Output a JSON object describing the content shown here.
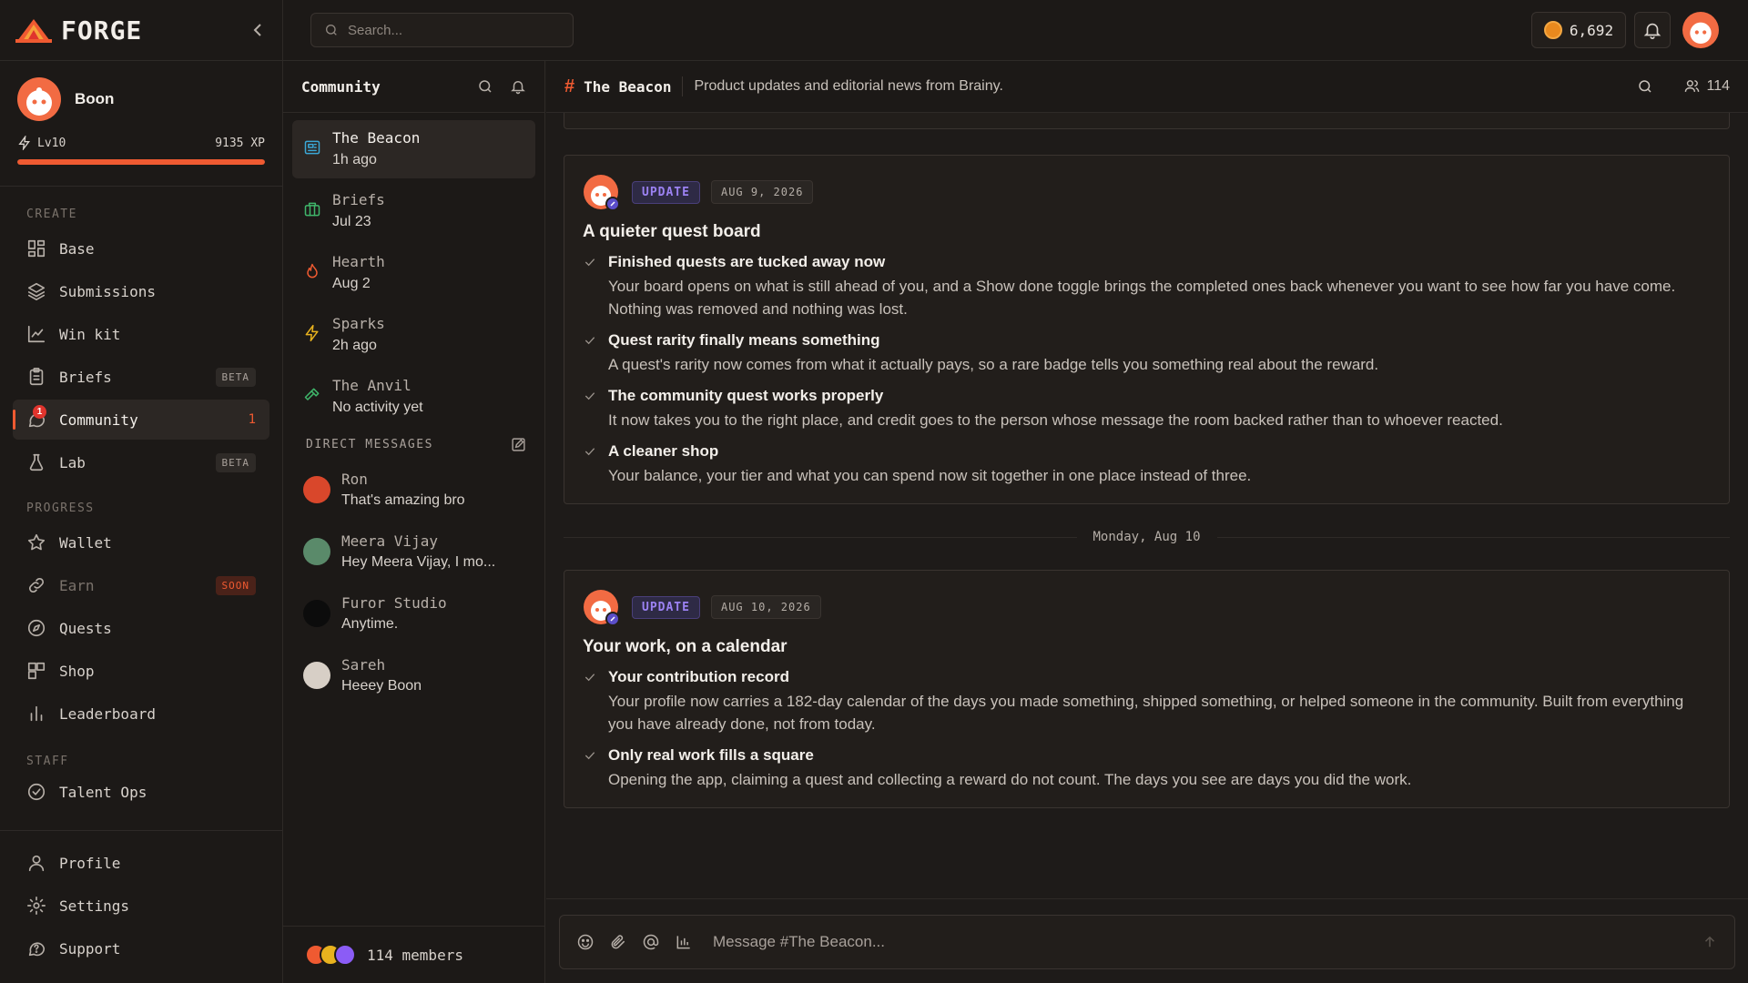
{
  "app": {
    "name": "FORGE",
    "brand_color": "#ef5a31"
  },
  "topbar": {
    "search_placeholder": "Search...",
    "coins": "6,692"
  },
  "user": {
    "name": "Boon",
    "level": "Lv10",
    "xp": "9135 XP",
    "xp_progress": 1.0
  },
  "sidebar": {
    "sections": {
      "create": "CREATE",
      "progress": "PROGRESS",
      "staff": "STAFF"
    },
    "create_items": [
      {
        "label": "Base",
        "icon": "grid-icon"
      },
      {
        "label": "Submissions",
        "icon": "layers-icon"
      },
      {
        "label": "Win kit",
        "icon": "chart-line-icon"
      },
      {
        "label": "Briefs",
        "icon": "clipboard-icon",
        "badge": "BETA"
      },
      {
        "label": "Community",
        "icon": "chat-icon",
        "count": "1",
        "dot": "1"
      },
      {
        "label": "Lab",
        "icon": "flask-icon",
        "badge": "BETA"
      }
    ],
    "progress_items": [
      {
        "label": "Wallet",
        "icon": "star-icon"
      },
      {
        "label": "Earn",
        "icon": "link-icon",
        "badge": "SOON"
      },
      {
        "label": "Quests",
        "icon": "compass-icon"
      },
      {
        "label": "Shop",
        "icon": "blocks-icon"
      },
      {
        "label": "Leaderboard",
        "icon": "bar-chart-icon"
      }
    ],
    "staff_items": [
      {
        "label": "Talent Ops",
        "icon": "check-circle-icon"
      }
    ],
    "bottom_items": [
      {
        "label": "Profile",
        "icon": "user-icon"
      },
      {
        "label": "Settings",
        "icon": "gear-icon"
      },
      {
        "label": "Support",
        "icon": "help-icon"
      }
    ]
  },
  "community": {
    "title": "Community",
    "channels": [
      {
        "name": "The Beacon",
        "sub": "1h ago",
        "icon": "newspaper-icon",
        "color": "#3ba7d6"
      },
      {
        "name": "Briefs",
        "sub": "Jul 23",
        "icon": "briefcase-icon",
        "color": "#3fb56a"
      },
      {
        "name": "Hearth",
        "sub": "Aug 2",
        "icon": "flame-icon",
        "color": "#ef5a31"
      },
      {
        "name": "Sparks",
        "sub": "2h ago",
        "icon": "bolt-icon",
        "color": "#e8b21e"
      },
      {
        "name": "The Anvil",
        "sub": "No activity yet",
        "icon": "hammer-icon",
        "color": "#3fb56a"
      }
    ],
    "dm_title": "DIRECT MESSAGES",
    "dms": [
      {
        "name": "Ron",
        "sub": "That's amazing bro",
        "avatar_color": "#d9472b"
      },
      {
        "name": "Meera Vijay",
        "sub": "Hey Meera Vijay, I mo...",
        "avatar_color": "#5a8a6a"
      },
      {
        "name": "Furor Studio",
        "sub": "Anytime.",
        "avatar_color": "#0c0c0c"
      },
      {
        "name": "Sareh",
        "sub": "Heeey Boon",
        "avatar_color": "#d7cfc6"
      }
    ],
    "members": "114 members"
  },
  "channel": {
    "name": "The Beacon",
    "description": "Product updates and editorial news from Brainy.",
    "member_count": "114"
  },
  "posts": [
    {
      "tag": "UPDATE",
      "date": "AUG 9, 2026",
      "title": "A quieter quest board",
      "points": [
        {
          "title": "Finished quests are tucked away now",
          "desc": "Your board opens on what is still ahead of you, and a Show done toggle brings the completed ones back whenever you want to see how far you have come. Nothing was removed and nothing was lost."
        },
        {
          "title": "Quest rarity finally means something",
          "desc": "A quest's rarity now comes from what it actually pays, so a rare badge tells you something real about the reward."
        },
        {
          "title": "The community quest works properly",
          "desc": "It now takes you to the right place, and credit goes to the person whose message the room backed rather than to whoever reacted."
        },
        {
          "title": "A cleaner shop",
          "desc": "Your balance, your tier and what you can spend now sit together in one place instead of three."
        }
      ]
    },
    {
      "tag": "UPDATE",
      "date": "AUG 10, 2026",
      "title": "Your work, on a calendar",
      "points": [
        {
          "title": "Your contribution record",
          "desc": "Your profile now carries a 182-day calendar of the days you made something, shipped something, or helped someone in the community. Built from everything you have already done, not from today."
        },
        {
          "title": "Only real work fills a square",
          "desc": "Opening the app, claiming a quest and collecting a reward do not count. The days you see are days you did the work."
        }
      ]
    }
  ],
  "day_separator": "Monday, Aug 10",
  "composer": {
    "placeholder": "Message #The Beacon..."
  }
}
